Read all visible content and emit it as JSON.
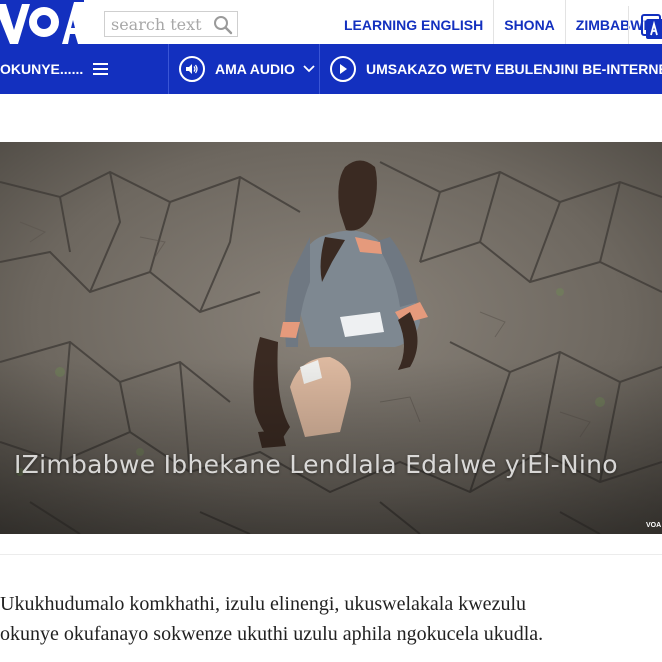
{
  "header": {
    "search_placeholder": "search text",
    "links": [
      "LEARNING ENGLISH",
      "SHONA",
      "ZIMBABWE"
    ]
  },
  "nav": {
    "section_label": "OKUNYE......",
    "audio_label": "AMA AUDIO",
    "tv_label": "UMSAKAZO WETV EBULENJINI BE-INTERNET"
  },
  "hero": {
    "caption": "IZimbabwe Ibhekane Lendlala Edalwe yiEl-Nino",
    "watermark": "VOA"
  },
  "article": {
    "lead_line_1": "Ukukhudumalo komkhathi, izulu elinengi, ukuswelakala kwezulu",
    "lead_line_2": "okunye okufanayo sokwenze ukuthi uzulu aphila ngokucela ukudla."
  },
  "colors": {
    "brand_blue": "#1330bf",
    "white": "#ffffff"
  },
  "icons": [
    "voa-logo",
    "search-icon",
    "language-icon",
    "menu-icon",
    "audio-icon",
    "play-icon",
    "chevron-down-icon"
  ]
}
